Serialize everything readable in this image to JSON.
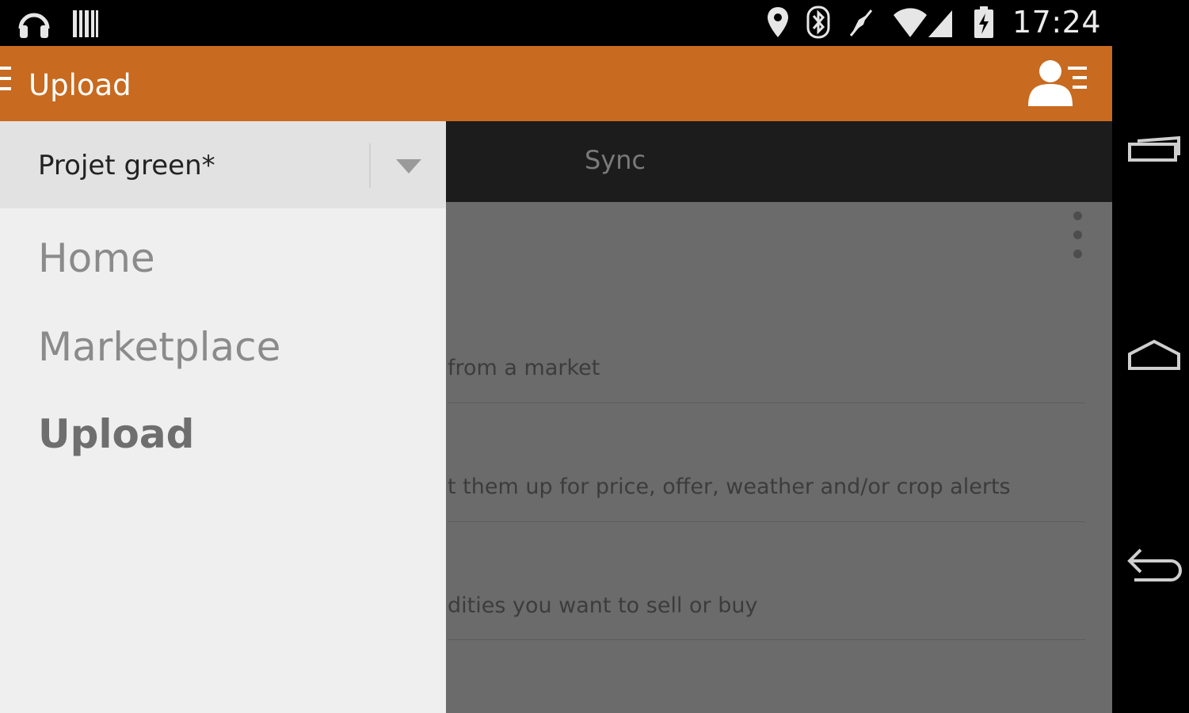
{
  "statusbar": {
    "time": "17:24",
    "left_icons": [
      "headphones-icon",
      "barcode-icon"
    ],
    "right_icons": [
      "location-icon",
      "bluetooth-icon",
      "mute-icon",
      "wifi-icon",
      "signal-icon",
      "battery-charging-icon"
    ]
  },
  "appbar": {
    "title": "Upload",
    "background": "#c86a1f",
    "right_icon": "account-list-icon"
  },
  "tabs": {
    "sync_label": "Sync"
  },
  "list": {
    "rows": [
      {
        "text": "from a market"
      },
      {
        "text": "t them up for price, offer, weather and/or crop alerts"
      },
      {
        "text": "dities you want to sell or buy"
      }
    ]
  },
  "drawer": {
    "project_selector": {
      "value": "Projet green*"
    },
    "items": [
      {
        "label": "Home",
        "active": false
      },
      {
        "label": "Marketplace",
        "active": false
      },
      {
        "label": "Upload",
        "active": true
      }
    ]
  },
  "navbar": {
    "buttons": [
      "recent-apps-icon",
      "home-icon",
      "back-icon"
    ]
  }
}
